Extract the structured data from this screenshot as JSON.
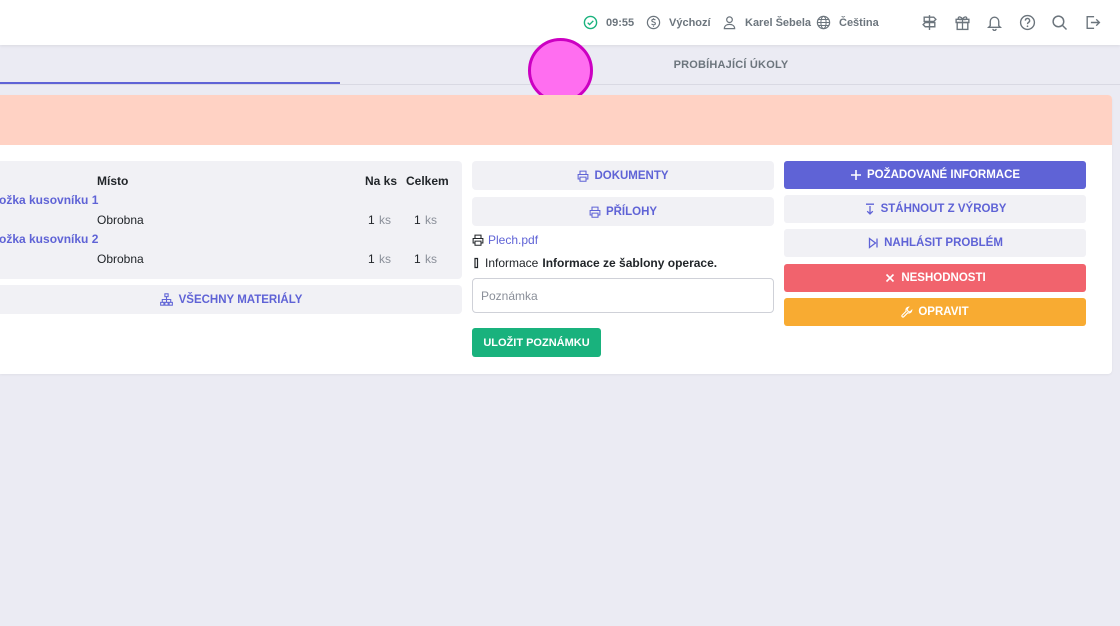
{
  "topbar": {
    "time": "09:55",
    "price_list": "Výchozí",
    "user": "Karel Šebela",
    "language": "Čeština",
    "icons": [
      "signpost-icon",
      "gift-icon",
      "bell-icon",
      "help-icon",
      "search-icon",
      "logout-icon"
    ]
  },
  "tabs": {
    "active_tab_label": "",
    "other_tab_label": "PROBÍHAJÍCÍ ÚKOLY"
  },
  "materials": {
    "headers": {
      "place": "Místo",
      "per_piece": "Na ks",
      "total": "Celkem"
    },
    "rows": [
      {
        "name": "ožka kusovníku 1",
        "place": "Obrobna",
        "per_piece": "1",
        "per_piece_unit": "ks",
        "total": "1",
        "total_unit": "ks"
      },
      {
        "name": "ožka kusovníku 2",
        "place": "Obrobna",
        "per_piece": "1",
        "per_piece_unit": "ks",
        "total": "1",
        "total_unit": "ks"
      }
    ],
    "all_materials_label": "VŠECHNY MATERIÁLY"
  },
  "middle": {
    "documents_label": "DOKUMENTY",
    "attachments_label": "PŘÍLOHY",
    "file_name": "Plech.pdf",
    "info_label": "Informace",
    "info_text": "Informace ze šablony operace.",
    "note_placeholder": "Poznámka",
    "save_note_label": "ULOŽIT POZNÁMKU"
  },
  "actions": {
    "requested_info": "POŽADOVANÉ INFORMACE",
    "download_from_production": "STÁHNOUT Z VÝROBY",
    "report_problem": "NAHLÁSIT PROBLÉM",
    "nonconformities": "NESHODNOSTI",
    "repair": "OPRAVIT"
  },
  "colors": {
    "accent": "#5f63d6",
    "success": "#19b27d",
    "danger": "#f1636d",
    "warning": "#f8ab32",
    "header_band": "#ffd2c4"
  }
}
